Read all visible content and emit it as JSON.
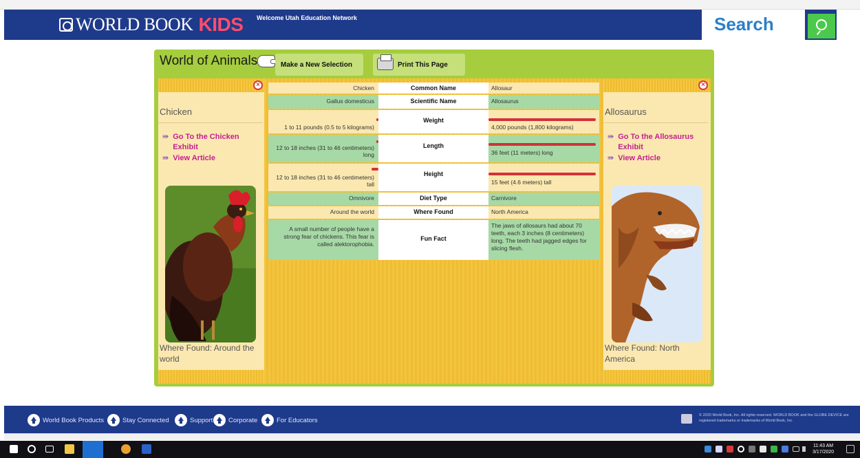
{
  "header": {
    "logo_text": "WORLD BOOK",
    "logo_kids": "KIDS",
    "welcome": "Welcome Utah Education Network",
    "search_label": "Search"
  },
  "toolbar": {
    "title": "World of Animals",
    "select_label": "Make a New Selection",
    "print_label": "Print This Page"
  },
  "left_animal": {
    "name": "Chicken",
    "link_exhibit_line1": "Go To the Chicken",
    "link_exhibit_line2": "Exhibit",
    "link_article": "View Article",
    "where_found": "Where Found: Around the world"
  },
  "right_animal": {
    "name": "Allosaurus",
    "link_exhibit_line1": "Go To the Allosaurus",
    "link_exhibit_line2": "Exhibit",
    "link_article": "View Article",
    "where_found": "Where Found: North America"
  },
  "comparison": {
    "rows": [
      {
        "label": "Common Name",
        "left": "Chicken",
        "right": "Allosaur"
      },
      {
        "label": "Scientific Name",
        "left": "Gallus domesticus",
        "right": "Allosaurus"
      },
      {
        "label": "Weight",
        "left": "1 to 11 pounds (0.5 to 5 kilograms)",
        "right": "4,000 pounds (1,800 kilograms)"
      },
      {
        "label": "Length",
        "left": "12 to 18 inches (31 to 46 centimeters) long",
        "right": "36 feet (11 meters) long"
      },
      {
        "label": "Height",
        "left": "12 to 18 inches (31 to 46 centimeters) tall",
        "right": "15 feet (4.6 meters) tall"
      },
      {
        "label": "Diet Type",
        "left": "Omnivore",
        "right": "Carnivore"
      },
      {
        "label": "Where Found",
        "left": "Around the world",
        "right": "North America"
      },
      {
        "label": "Fun Fact",
        "left": "A small number of people have a strong fear of chickens. This fear is called alektorophobia.",
        "right": "The jaws of allosaurs had about 70 teeth, each 3 inches (8 centimeters) long. The teeth had jagged edges for slicing flesh."
      }
    ]
  },
  "footer": {
    "items": [
      "World Book Products",
      "Stay Connected",
      "Support",
      "Corporate",
      "For Educators"
    ],
    "copyright": "© 2020 World Book, Inc. All rights reserved. WORLD BOOK and the GLOBE DEVICE are registered trademarks or trademarks of World Book, Inc."
  },
  "taskbar": {
    "time": "11:43 AM",
    "date": "3/17/2020"
  },
  "colors": {
    "header_blue": "#1e3a8a",
    "panel_green": "#a6cd3d",
    "link_magenta": "#c2218f",
    "bar_red": "#d6303a"
  }
}
